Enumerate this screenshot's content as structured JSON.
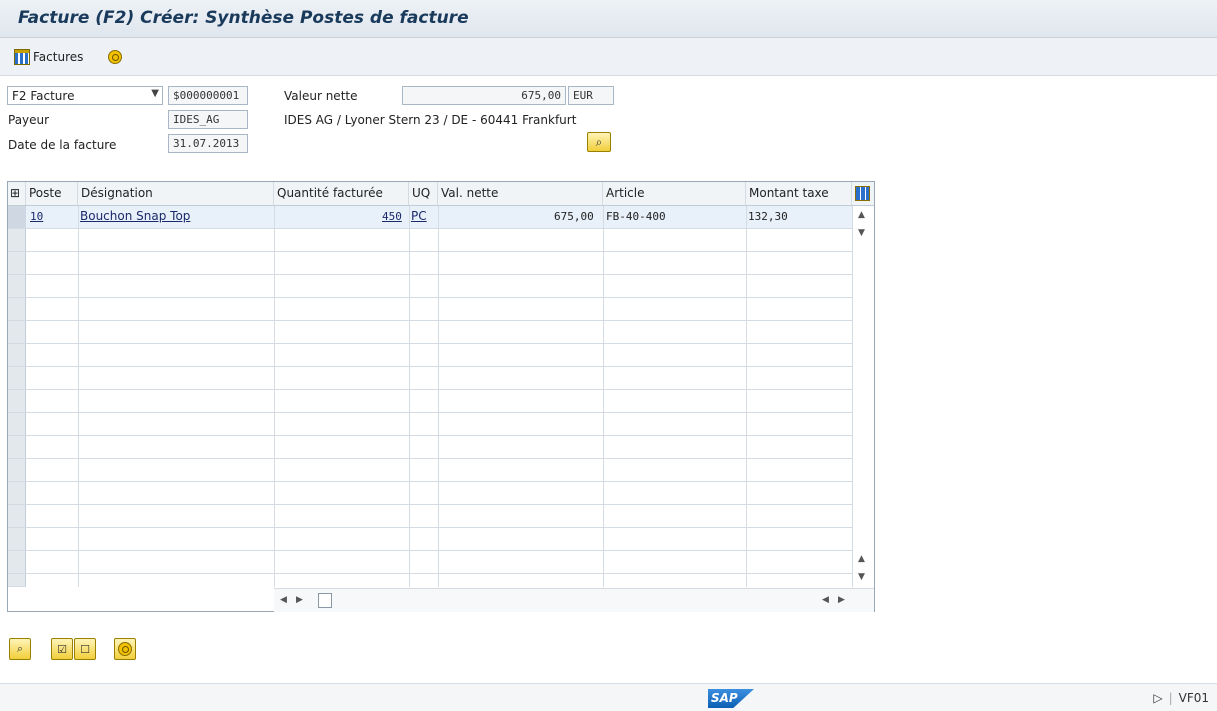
{
  "window": {
    "title": "Facture  (F2) Créer: Synthèse Postes de facture"
  },
  "toolbar": {
    "factures_label": "Factures"
  },
  "header": {
    "doc_type": "F2 Facture",
    "doc_number": "$000000001",
    "net_value_label": "Valeur nette",
    "net_value": "675,00",
    "currency": "EUR",
    "payer_label": "Payeur",
    "payer": "IDES_AG",
    "payer_address": "IDES AG / Lyoner Stern 23 / DE - 60441 Frankfurt",
    "invoice_date_label": "Date de la facture",
    "invoice_date": "31.07.2013"
  },
  "table": {
    "columns": [
      "Poste",
      "Désignation",
      "Quantité facturée",
      "UQ",
      "Val. nette",
      "Article",
      "Montant taxe"
    ],
    "rows": [
      {
        "poste": "10",
        "designation": "Bouchon Snap Top",
        "quantite": "450",
        "uq": "PC",
        "val_nette": "675,00",
        "article": "FB-40-400",
        "montant_taxe": "132,30"
      }
    ]
  },
  "statusbar": {
    "brand": "SAP",
    "transaction": "VF01"
  },
  "colors": {
    "title": "#1a3a5c",
    "selected_row": "#e8f0f9",
    "button_yellow": "#f1cf3a"
  }
}
